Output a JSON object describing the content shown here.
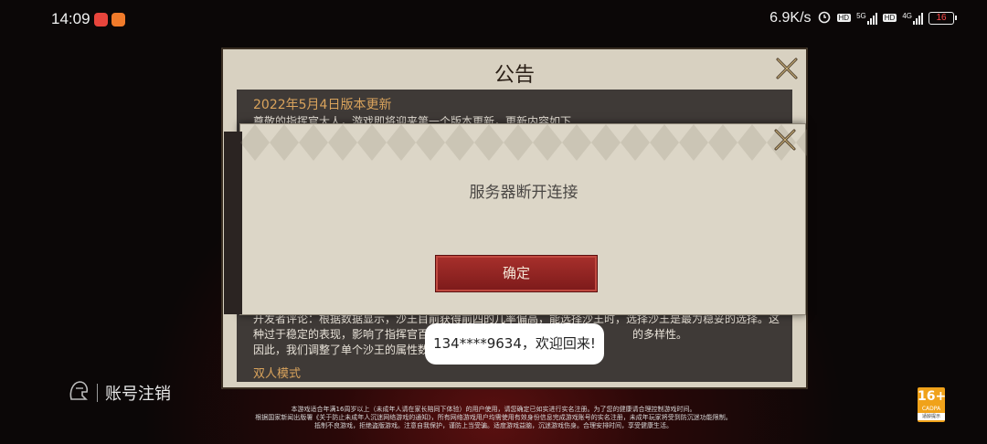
{
  "status_bar": {
    "time": "14:09",
    "net_speed": "6.9K/s",
    "sig1": "5G",
    "sig2": "4G",
    "battery": "16",
    "battery_color": "#ff4a4a",
    "icons": [
      "app-notification-icon",
      "app-notification-icon-2",
      "alarm-icon",
      "hd-icon",
      "signal-icon",
      "battery-icon"
    ]
  },
  "notice": {
    "title": "公告",
    "heading": "2022年5月4日版本更新",
    "lines": [
      "尊敬的指挥官大人，游戏即将迎来第一个版本更新，更新内容如下",
      "开发者评论：根据数据显示，沙王目前获得前四的几率偏高，能选择沙王时，选择沙王是最为稳妥的选择。这",
      "种过于稳定的表现，影响了指挥官百",
      "的多样性。",
      "因此，我们调整了单个沙王的属性数"
    ],
    "subheading": "双人模式"
  },
  "dialog": {
    "message": "服务器断开连接",
    "confirm_label": "确定"
  },
  "toast": {
    "text": "134****9634，欢迎回来!"
  },
  "account": {
    "label": "账号注销"
  },
  "footer": {
    "lines": [
      "本游戏适合年满16周岁以上（未成年人请在家长陪同下体验）的用户使用，请您确定已如实进行实名注册。为了您的健康请合理控制游戏时间。",
      "根据国家新闻出版署《关于防止未成年人沉迷网络游戏的通知》，所有网络游戏用户均需使用有效身份信息完成游戏账号的实名注册，未成年玩家将受到防沉迷功能限制。",
      "抵制不良游戏，拒绝盗版游戏。注意自我保护，谨防上当受骗。适度游戏益脑，沉迷游戏伤身。合理安排时间，享受健康生活。"
    ]
  },
  "age_badge": {
    "rating": "16+",
    "sub": "CADPA",
    "foot": "适龄提示",
    "color": "#f0a21a"
  }
}
